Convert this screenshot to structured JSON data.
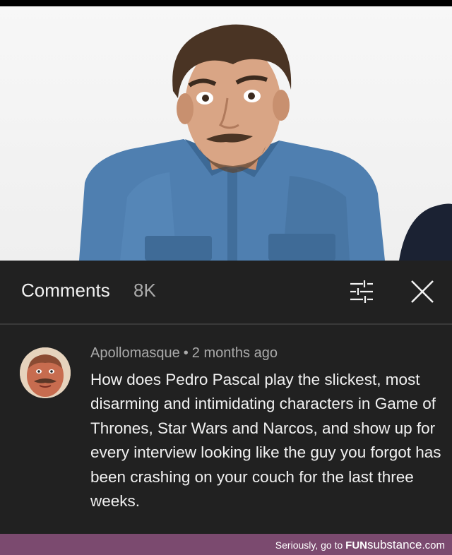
{
  "video": {
    "progress": 0.05
  },
  "comments": {
    "title": "Comments",
    "count": "8K",
    "icons": {
      "filter": "sort-sliders-icon",
      "close": "close-icon"
    }
  },
  "comment": {
    "author": "Apollomasque",
    "separator": "•",
    "time": "2 months ago",
    "text": "How does Pedro Pascal play the slickest, most disarming and intimidating characters in Game of Thrones, Star Wars and Narcos, and show up for every interview looking like the guy you forgot has been crashing on your couch for the last three weeks."
  },
  "footer": {
    "prefix": "Seriously, go to",
    "brand_fun": "FUN",
    "brand_rest": "substance",
    "brand_tld": ".com"
  },
  "colors": {
    "background": "#212121",
    "text_primary": "#f1f1f1",
    "text_secondary": "#aaaaaa",
    "progress": "#ff0000",
    "footer": "#7b4a6f"
  }
}
